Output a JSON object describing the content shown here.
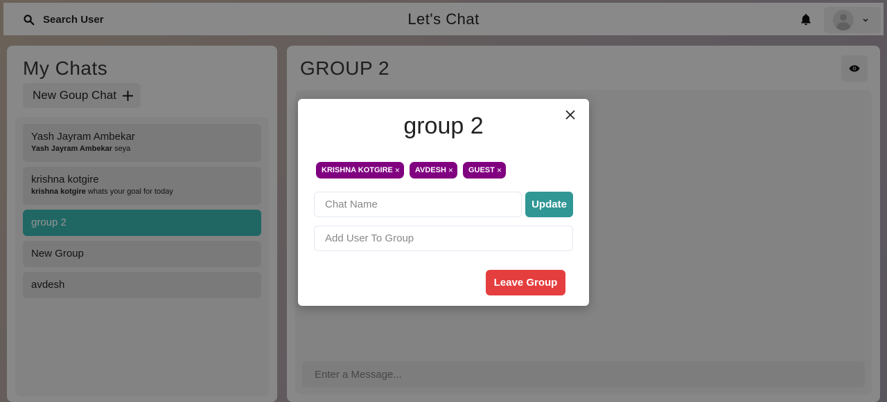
{
  "header": {
    "search_label": "Search User",
    "app_title": "Let's Chat",
    "icons": {
      "search": "search-icon",
      "bell": "bell-icon",
      "avatar": "avatar-icon",
      "menu": "chevron-down-icon"
    }
  },
  "sidebar": {
    "title": "My Chats",
    "new_group_label": "New Goup Chat",
    "new_group_icon": "plus-icon",
    "chats": [
      {
        "name": "Yash Jayram Ambekar",
        "sender": "Yash Jayram Ambekar",
        "message": "seya"
      },
      {
        "name": "krishna kotgire",
        "sender": "krishna kotgire",
        "message": "whats your goal for today"
      },
      {
        "name": "group 2",
        "active": true
      },
      {
        "name": "New Group"
      },
      {
        "name": "avdesh"
      }
    ]
  },
  "chat_panel": {
    "title": "GROUP 2",
    "view_icon": "eye-icon",
    "message_placeholder": "Enter a Message..."
  },
  "modal": {
    "title": "group 2",
    "members": [
      "KRISHNA KOTGIRE",
      "AVDESH",
      "GUEST"
    ],
    "remove_glyph": "×",
    "chat_name_placeholder": "Chat Name",
    "update_label": "Update",
    "add_user_placeholder": "Add User To Group",
    "leave_label": "Leave Group"
  },
  "colors": {
    "accent_teal": "#38b2ac",
    "update_button": "#319795",
    "badge_purple": "#800080",
    "leave_red": "#e53e3e"
  }
}
